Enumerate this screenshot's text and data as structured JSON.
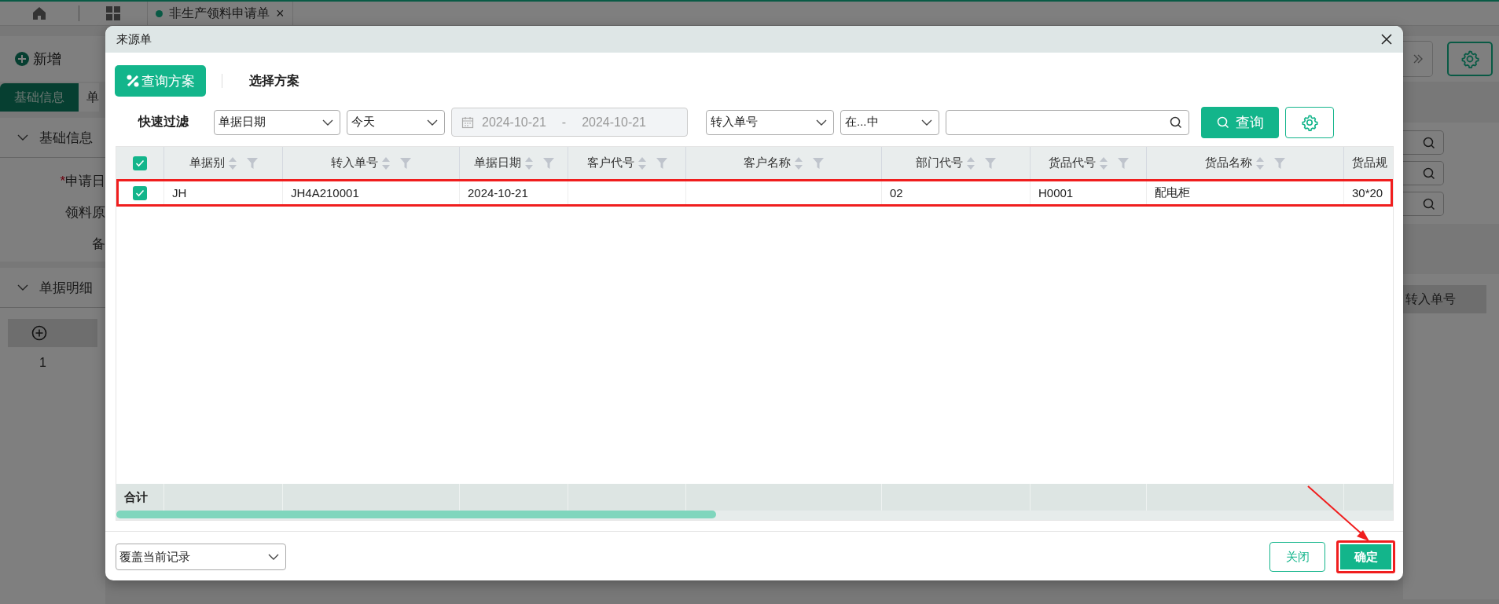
{
  "app_tabs": [
    {
      "label": "非生产领料申请单",
      "selected": true,
      "close_glyph": "×"
    }
  ],
  "toolbar": {
    "add_button": "新增"
  },
  "form_tabs": [
    {
      "label": "基础信息",
      "selected": true
    },
    {
      "label": "单",
      "selected": false
    }
  ],
  "sections": [
    {
      "title": "基础信息"
    },
    {
      "title": "单据明细"
    }
  ],
  "form_fields": [
    {
      "label": "申请日",
      "required_mark": "*"
    },
    {
      "label": "领料原"
    },
    {
      "label": "备"
    }
  ],
  "detail_grid": {
    "row_numbers": [
      "1"
    ],
    "visible_column": "转入单号"
  },
  "dialog": {
    "title": "来源单",
    "scheme_tabs": [
      {
        "label": "查询方案",
        "selected": true
      },
      {
        "label": "选择方案",
        "selected": false
      }
    ],
    "quick_filter_label": "快速过滤",
    "filters": {
      "field": "单据日期",
      "period": "今天",
      "date_from": "2024-10-21",
      "date_separator": "-",
      "date_to": "2024-10-21",
      "search_field": "转入单号",
      "operator": "在...中"
    },
    "search_button": "查询",
    "table": {
      "all_checked": true,
      "columns": [
        {
          "label": "单据别",
          "sortable": true
        },
        {
          "label": "转入单号",
          "sortable": true
        },
        {
          "label": "单据日期",
          "sortable": true
        },
        {
          "label": "客户代号",
          "sortable": true
        },
        {
          "label": "客户名称",
          "sortable": true
        },
        {
          "label": "部门代号",
          "sortable": true
        },
        {
          "label": "货品代号",
          "sortable": true
        },
        {
          "label": "货品名称",
          "sortable": true
        },
        {
          "label": "货品规"
        }
      ],
      "rows": [
        {
          "checked": true,
          "highlighted": true,
          "cells": [
            "JH",
            "JH4A210001",
            "2024-10-21",
            "",
            "",
            "02",
            "H0001",
            "配电柜",
            "30*20"
          ]
        }
      ],
      "footer_label": "合计"
    },
    "mode": "覆盖当前记录",
    "close_button": "关闭",
    "confirm_button": {
      "label": "确定",
      "highlighted": true
    }
  }
}
